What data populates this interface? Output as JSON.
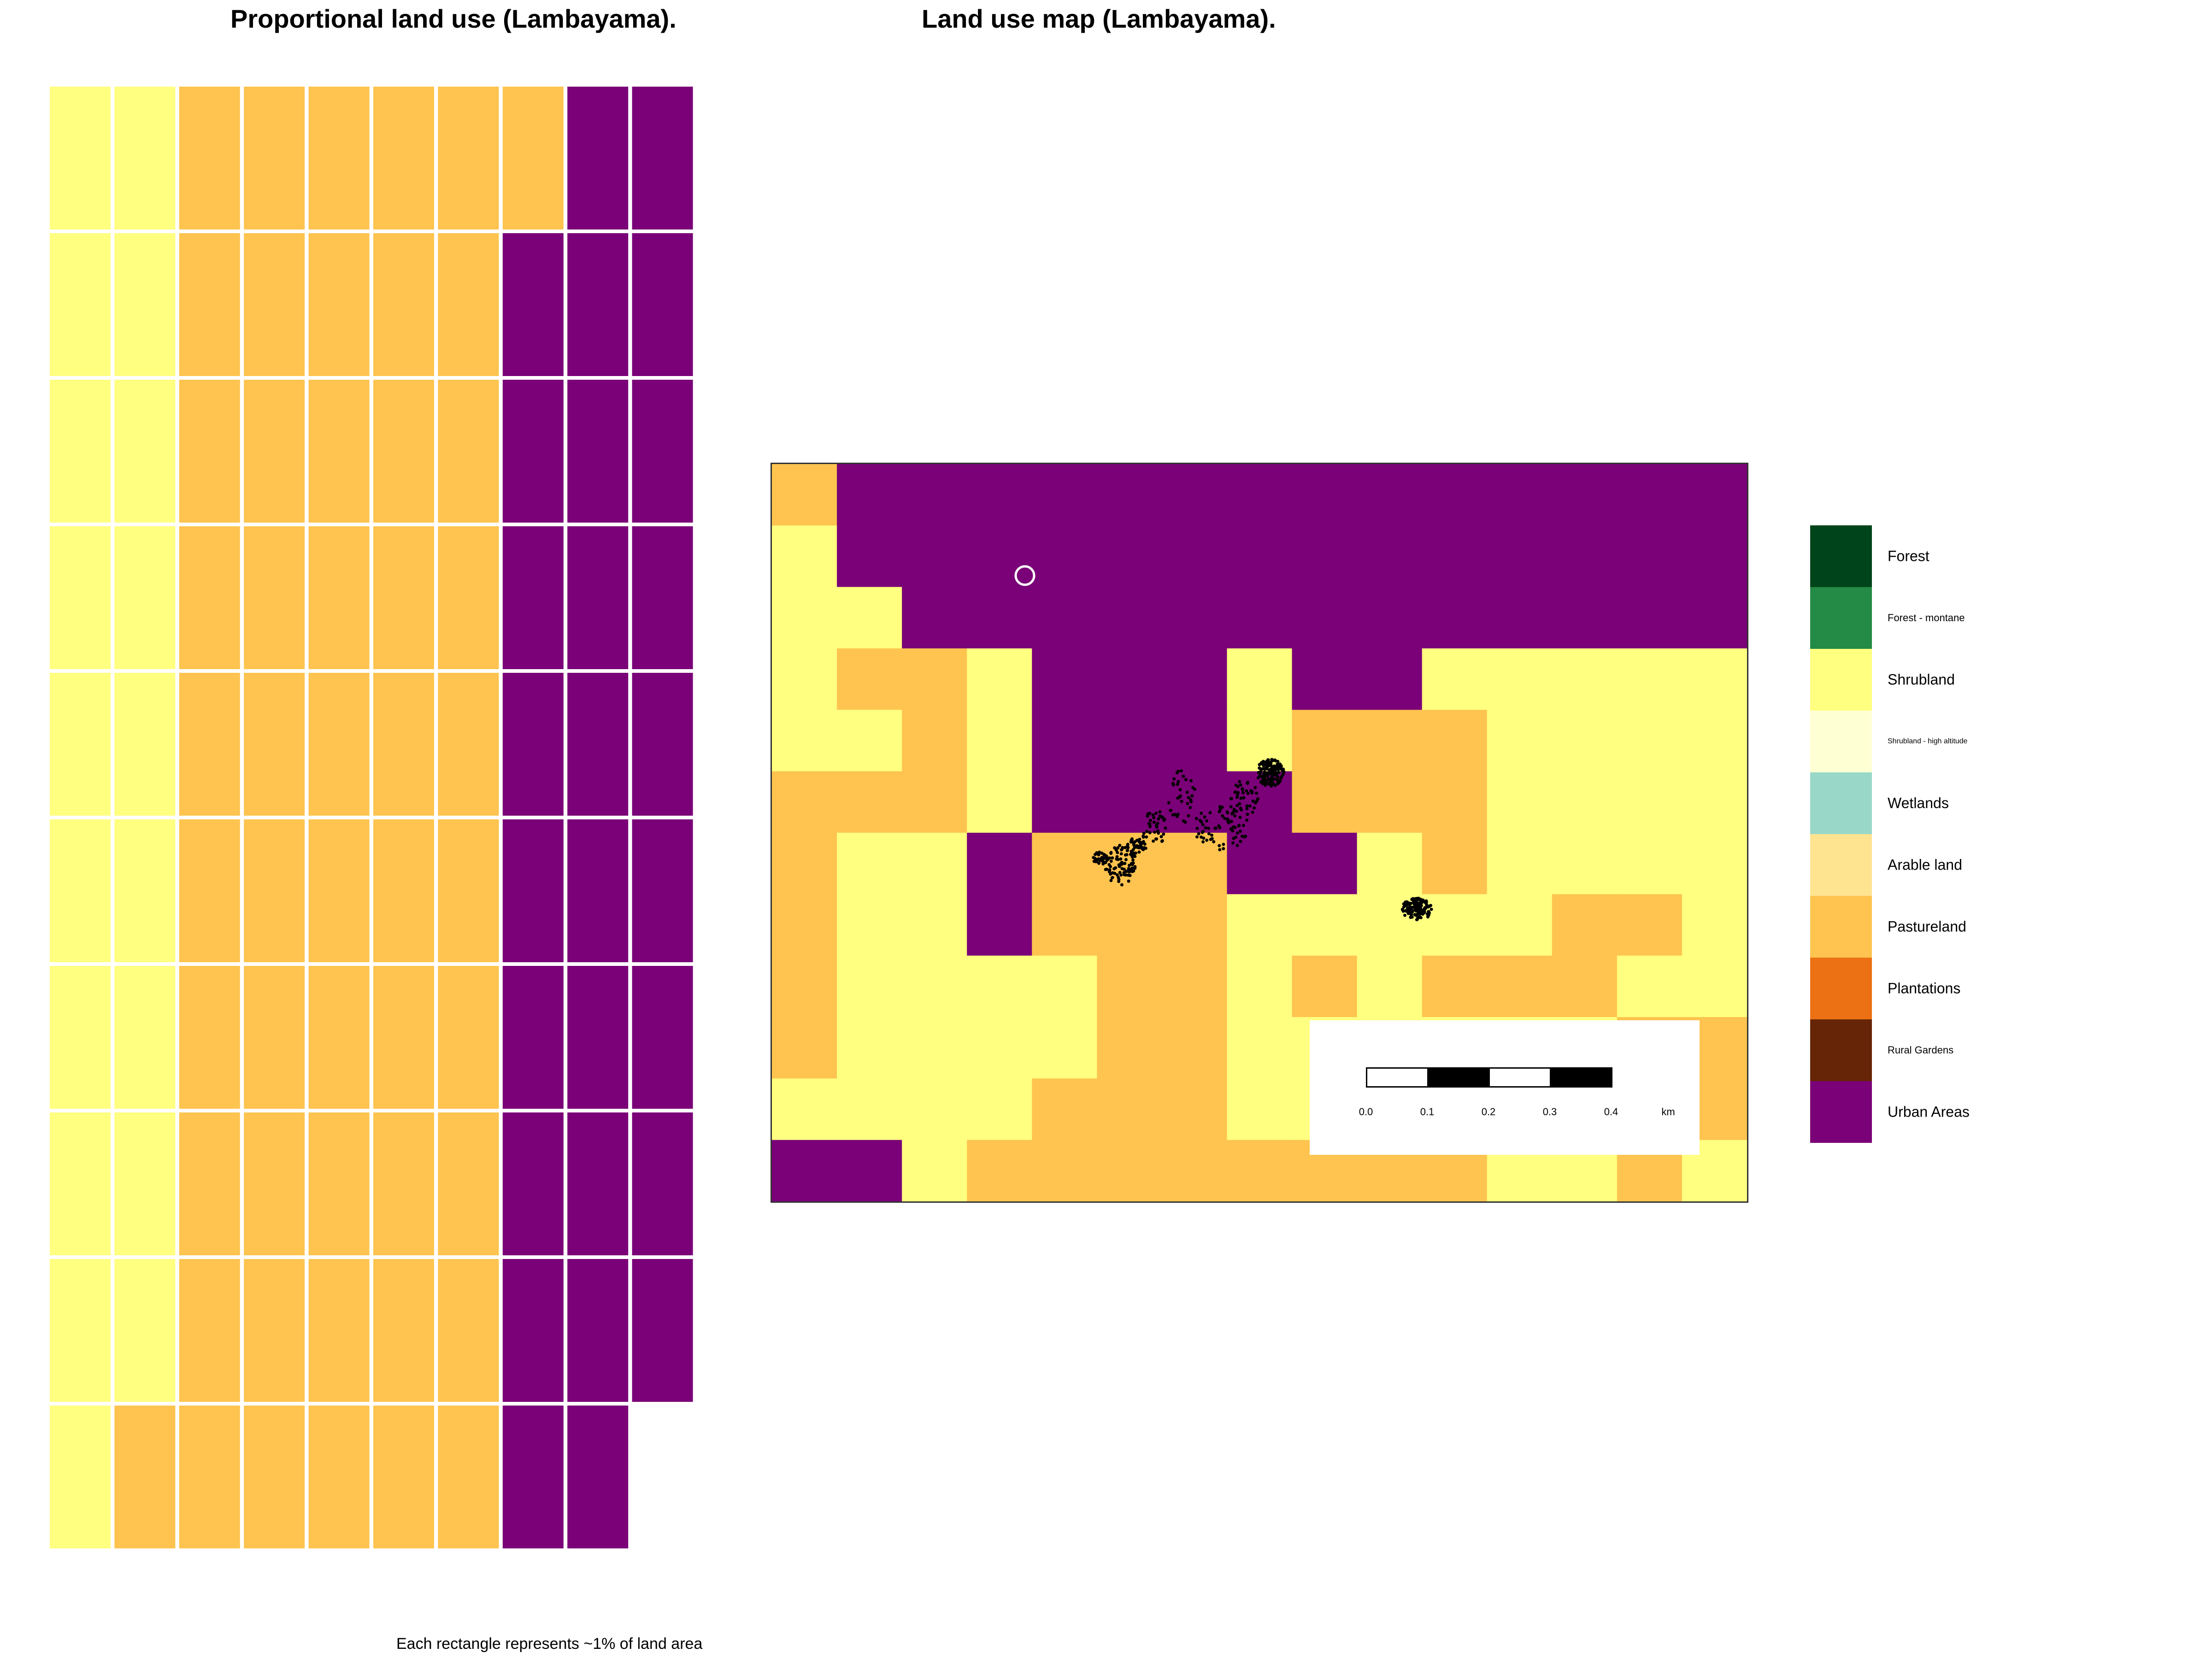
{
  "waffle": {
    "title": "Proportional land use (Lambayama).",
    "caption": "Each rectangle represents ~1% of land area",
    "columns": [
      [
        "Shrubland",
        "Shrubland",
        "Shrubland",
        "Shrubland",
        "Shrubland",
        "Shrubland",
        "Shrubland",
        "Shrubland",
        "Shrubland",
        "Shrubland"
      ],
      [
        "Pastureland",
        "Shrubland",
        "Shrubland",
        "Shrubland",
        "Shrubland",
        "Shrubland",
        "Shrubland",
        "Shrubland",
        "Shrubland",
        "Shrubland"
      ],
      [
        "Pastureland",
        "Pastureland",
        "Pastureland",
        "Pastureland",
        "Pastureland",
        "Pastureland",
        "Pastureland",
        "Pastureland",
        "Pastureland",
        "Pastureland"
      ],
      [
        "Pastureland",
        "Pastureland",
        "Pastureland",
        "Pastureland",
        "Pastureland",
        "Pastureland",
        "Pastureland",
        "Pastureland",
        "Pastureland",
        "Pastureland"
      ],
      [
        "Pastureland",
        "Pastureland",
        "Pastureland",
        "Pastureland",
        "Pastureland",
        "Pastureland",
        "Pastureland",
        "Pastureland",
        "Pastureland",
        "Pastureland"
      ],
      [
        "Pastureland",
        "Pastureland",
        "Pastureland",
        "Pastureland",
        "Pastureland",
        "Pastureland",
        "Pastureland",
        "Pastureland",
        "Pastureland",
        "Pastureland"
      ],
      [
        "Pastureland",
        "Pastureland",
        "Pastureland",
        "Pastureland",
        "Pastureland",
        "Pastureland",
        "Pastureland",
        "Pastureland",
        "Pastureland",
        "Pastureland"
      ],
      [
        "Urban Areas",
        "Urban Areas",
        "Urban Areas",
        "Urban Areas",
        "Urban Areas",
        "Urban Areas",
        "Urban Areas",
        "Urban Areas",
        "Urban Areas",
        "Pastureland"
      ],
      [
        "Urban Areas",
        "Urban Areas",
        "Urban Areas",
        "Urban Areas",
        "Urban Areas",
        "Urban Areas",
        "Urban Areas",
        "Urban Areas",
        "Urban Areas",
        "Urban Areas"
      ],
      [
        null,
        "Urban Areas",
        "Urban Areas",
        "Urban Areas",
        "Urban Areas",
        "Urban Areas",
        "Urban Areas",
        "Urban Areas",
        "Urban Areas",
        "Urban Areas"
      ]
    ]
  },
  "map": {
    "title": "Land use map (Lambayama).",
    "grid_rows": [
      "PUUUUUUUUUUUUUU",
      "SUUUUUUUUUUUUUU",
      "SSUUUUUUUUUUUUU",
      "SPPSUUUSUUSSSSS",
      "SSPSUUUSPPPSSSS",
      "PPPSUUUUPPPSSSS",
      "PSSUPPPUUSPSSSS",
      "PSSUPPPSSSSSPPS",
      "PSSSSPPSPSPPPSS",
      "PSSSSPPSSSSSSPP",
      "SSSSPPPSSSSSSSP",
      "UUSPPPPPPPPSSPS"
    ],
    "grid_codes": {
      "S": "Shrubland",
      "P": "Pastureland",
      "U": "Urban Areas"
    }
  },
  "scale_bar": {
    "ticks": [
      "0.0",
      "0.1",
      "0.2",
      "0.3",
      "0.4"
    ],
    "unit": "km"
  },
  "legend": [
    {
      "label": "Forest",
      "color": "#00441b",
      "size": "normal"
    },
    {
      "label": "Forest - montane",
      "color": "#238b45",
      "size": "small"
    },
    {
      "label": "Shrubland",
      "color": "#ffff80",
      "size": "normal"
    },
    {
      "label": "Shrubland - high altitude",
      "color": "#ffffd4",
      "size": "tiny"
    },
    {
      "label": "Wetlands",
      "color": "#99d8c9",
      "size": "normal"
    },
    {
      "label": "Arable land",
      "color": "#fee391",
      "size": "normal"
    },
    {
      "label": "Pastureland",
      "color": "#fec44f",
      "size": "normal"
    },
    {
      "label": "Plantations",
      "color": "#ec7014",
      "size": "normal"
    },
    {
      "label": "Rural Gardens",
      "color": "#662506",
      "size": "small"
    },
    {
      "label": "Urban Areas",
      "color": "#7a0177",
      "size": "normal"
    }
  ],
  "colors": {
    "Shrubland": "#ffff80",
    "Pastureland": "#fec44f",
    "Urban Areas": "#7a0177"
  }
}
